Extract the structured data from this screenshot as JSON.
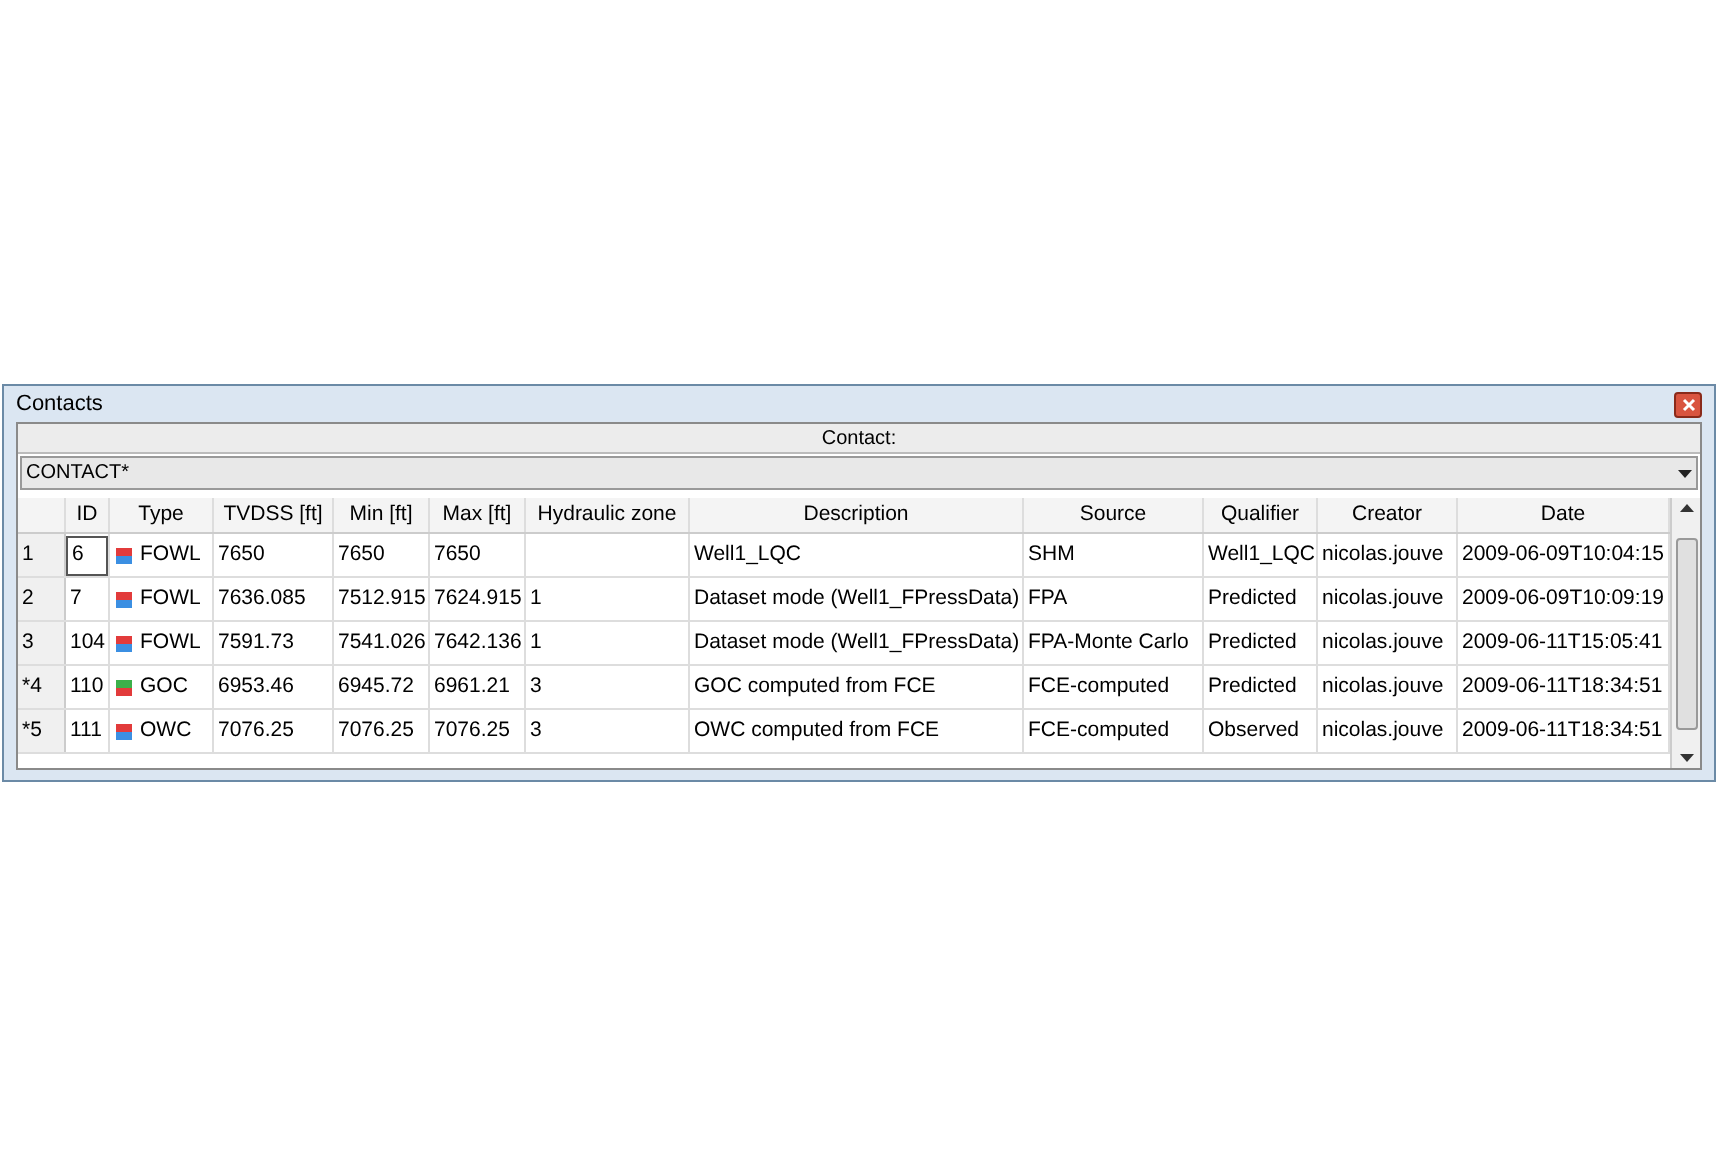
{
  "window": {
    "title": "Contacts"
  },
  "contact_header": "Contact:",
  "contact_select": {
    "value": "CONTACT*"
  },
  "table": {
    "columns": [
      "ID",
      "Type",
      "TVDSS [ft]",
      "Min [ft]",
      "Max [ft]",
      "Hydraulic zone",
      "Description",
      "Source",
      "Qualifier",
      "Creator",
      "Date"
    ],
    "rows": [
      {
        "header": "1",
        "id": "6",
        "editing": true,
        "type": "FOWL",
        "swatch": [
          {
            "color": "#e23b3b"
          },
          {
            "color": "#3b8fe2"
          }
        ],
        "tvdss": "7650",
        "min": "7650",
        "max": "7650",
        "zone": "",
        "description": "Well1_LQC",
        "source": "SHM",
        "qualifier": "Well1_LQC",
        "creator": "nicolas.jouve",
        "date": "2009-06-09T10:04:15"
      },
      {
        "header": "2",
        "id": "7",
        "editing": false,
        "type": "FOWL",
        "swatch": [
          {
            "color": "#e23b3b"
          },
          {
            "color": "#3b8fe2"
          }
        ],
        "tvdss": "7636.085",
        "min": "7512.915",
        "max": "7624.915",
        "zone": "1",
        "description": "Dataset mode (Well1_FPressData)",
        "source": "FPA",
        "qualifier": "Predicted",
        "creator": "nicolas.jouve",
        "date": "2009-06-09T10:09:19"
      },
      {
        "header": "3",
        "id": "104",
        "editing": false,
        "type": "FOWL",
        "swatch": [
          {
            "color": "#e23b3b"
          },
          {
            "color": "#3b8fe2"
          }
        ],
        "tvdss": "7591.73",
        "min": "7541.026",
        "max": "7642.136",
        "zone": "1",
        "description": "Dataset mode (Well1_FPressData)",
        "source": "FPA-Monte Carlo",
        "qualifier": "Predicted",
        "creator": "nicolas.jouve",
        "date": "2009-06-11T15:05:41"
      },
      {
        "header": "*4",
        "id": "110",
        "editing": false,
        "type": "GOC",
        "swatch": [
          {
            "color": "#3bb04a"
          },
          {
            "color": "#e23b3b"
          }
        ],
        "tvdss": "6953.46",
        "min": "6945.72",
        "max": "6961.21",
        "zone": "3",
        "description": "GOC computed from FCE",
        "source": "FCE-computed",
        "qualifier": "Predicted",
        "creator": "nicolas.jouve",
        "date": "2009-06-11T18:34:51"
      },
      {
        "header": "*5",
        "id": "111",
        "editing": false,
        "type": "OWC",
        "swatch": [
          {
            "color": "#e23b3b"
          },
          {
            "color": "#3b8fe2"
          }
        ],
        "tvdss": "7076.25",
        "min": "7076.25",
        "max": "7076.25",
        "zone": "3",
        "description": "OWC computed from FCE",
        "source": "FCE-computed",
        "qualifier": "Observed",
        "creator": "nicolas.jouve",
        "date": "2009-06-11T18:34:51"
      }
    ]
  }
}
